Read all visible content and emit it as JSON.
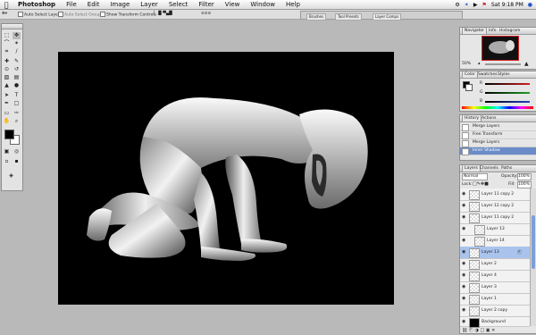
{
  "menubar": {
    "app_name": "Photoshop",
    "menus": [
      "File",
      "Edit",
      "Image",
      "Layer",
      "Select",
      "Filter",
      "View",
      "Window",
      "Help"
    ],
    "right_status": "Sat 9:18 PM"
  },
  "options_bar": {
    "auto_select_layer": "Auto Select Layer",
    "auto_select_groups": "Auto Select Groups",
    "show_transform_controls": "Show Transform Controls",
    "well_tabs": [
      "Brushes",
      "Tool Presets",
      "Layer Comps"
    ]
  },
  "navigator": {
    "tabs": [
      "Navigator",
      "Info",
      "Histogram"
    ],
    "zoom_value": "50%"
  },
  "color": {
    "tabs": [
      "Color",
      "Swatches",
      "Styles"
    ],
    "channels": [
      "R",
      "G",
      "B"
    ],
    "colors": {
      "r": "#d02020",
      "g": "#20a020",
      "b": "#2040c8"
    }
  },
  "history": {
    "tabs": [
      "History",
      "Actions"
    ],
    "items": [
      "Merge Layers",
      "Free Transform",
      "Merge Layers",
      "Inner Shadow"
    ]
  },
  "layers": {
    "tabs": [
      "Layers",
      "Channels",
      "Paths"
    ],
    "blend_mode": "Normal",
    "opacity_label": "Opacity:",
    "opacity_value": "100%",
    "lock_label": "Lock:",
    "fill_label": "Fill:",
    "fill_value": "100%",
    "items": [
      "Layer 11 copy 2",
      "Layer 12 copy 2",
      "Layer 11 copy 2",
      "Layer 13",
      "Layer 14",
      "Layer 13",
      "Layer 2",
      "Layer 4",
      "Layer 3",
      "Layer 1",
      "Layer 2 copy",
      "Background"
    ]
  }
}
